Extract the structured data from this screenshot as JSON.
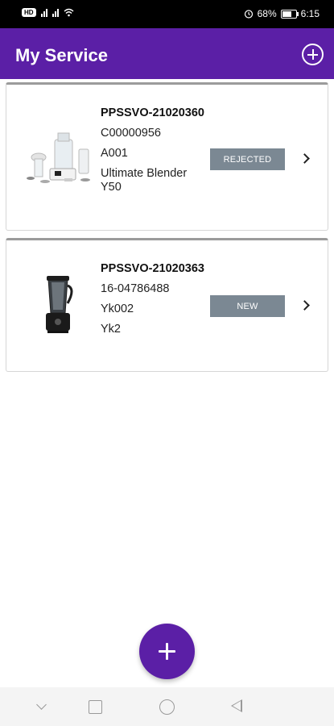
{
  "status_bar": {
    "hd_label": "HD",
    "battery_percent": "68%",
    "battery_level": 0.68,
    "time": "6:15"
  },
  "app_bar": {
    "title": "My Service",
    "add_icon": "add-circle-icon"
  },
  "services": [
    {
      "code": "PPSSVO-21020360",
      "customer": "C00000956",
      "model_code": "A001",
      "product_name": "Ultimate Blender Y50",
      "status": "REJECTED",
      "image_icon": "food-processor-image"
    },
    {
      "code": "PPSSVO-21020363",
      "customer": "16-04786488",
      "model_code": "Yk002",
      "product_name": "Yk2",
      "status": "NEW",
      "image_icon": "blender-image"
    }
  ],
  "fab": {
    "icon": "plus-icon"
  },
  "colors": {
    "primary": "#5b1fa6",
    "status_chip": "#7b8893"
  }
}
